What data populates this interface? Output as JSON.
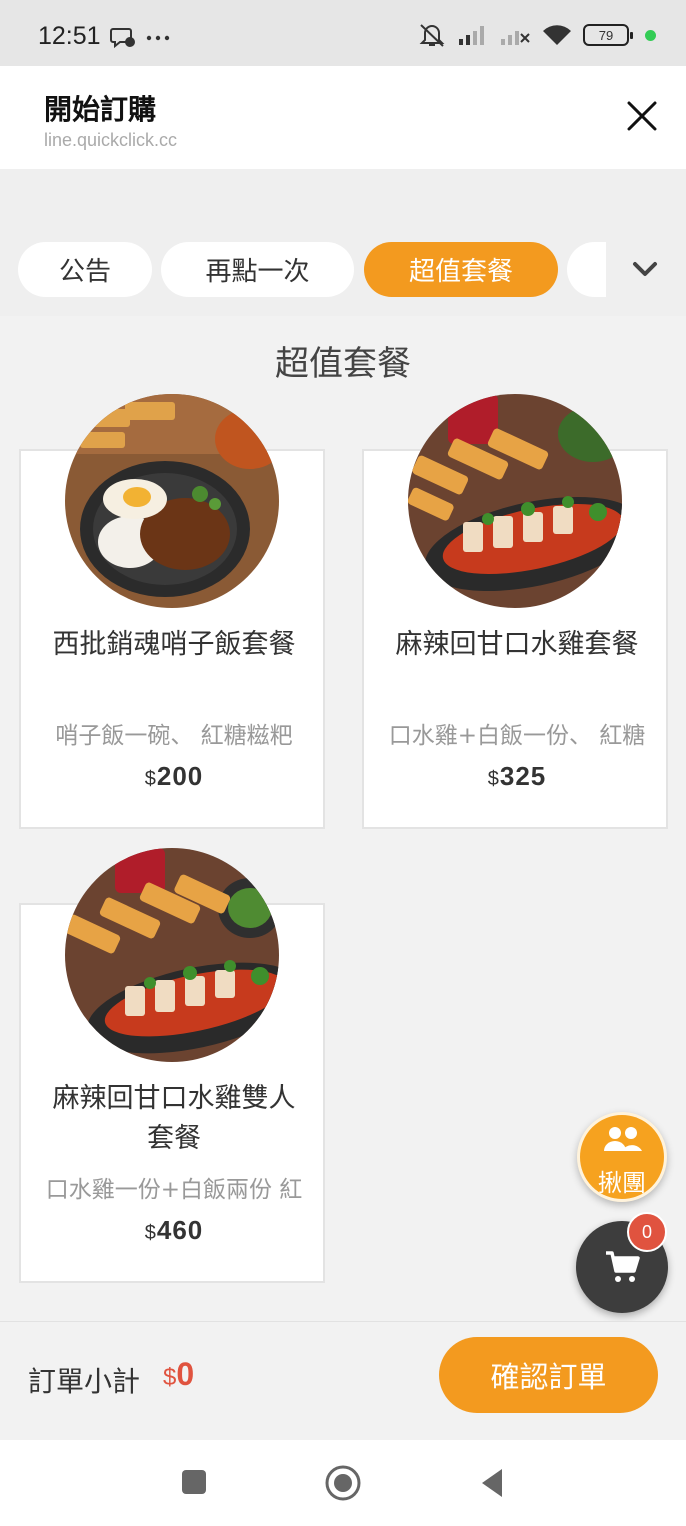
{
  "status_bar": {
    "time": "12:51",
    "battery": "79"
  },
  "header": {
    "title": "開始訂購",
    "url": "line.quickclick.cc",
    "close_icon": "close-icon"
  },
  "tabs": [
    {
      "label": "公告"
    },
    {
      "label": "再點一次"
    },
    {
      "label": "超值套餐",
      "active": true
    },
    {
      "label": ""
    }
  ],
  "section_title": "超值套餐",
  "items": [
    {
      "name": "西批銷魂哨子飯套餐",
      "desc": "哨子飯一碗、 紅糖糍粑",
      "currency": "$",
      "price": "200"
    },
    {
      "name": "麻辣回甘口水雞套餐",
      "desc": "口水雞+白飯一份、 紅糖",
      "currency": "$",
      "price": "325"
    },
    {
      "name": "麻辣回甘口水雞雙人套餐",
      "desc": "口水雞一份+白飯兩份 紅",
      "currency": "$",
      "price": "460"
    }
  ],
  "group_button": {
    "label": "揪團",
    "icon": "group-icon"
  },
  "cart": {
    "badge": "0",
    "icon": "cart-icon"
  },
  "footer": {
    "subtotal_label": "訂單小計",
    "currency": "$",
    "subtotal_value": "0",
    "confirm_label": "確認訂單"
  },
  "colors": {
    "accent": "#f39a1f",
    "price_red": "#e0533f",
    "dark": "#3d3d3d"
  }
}
